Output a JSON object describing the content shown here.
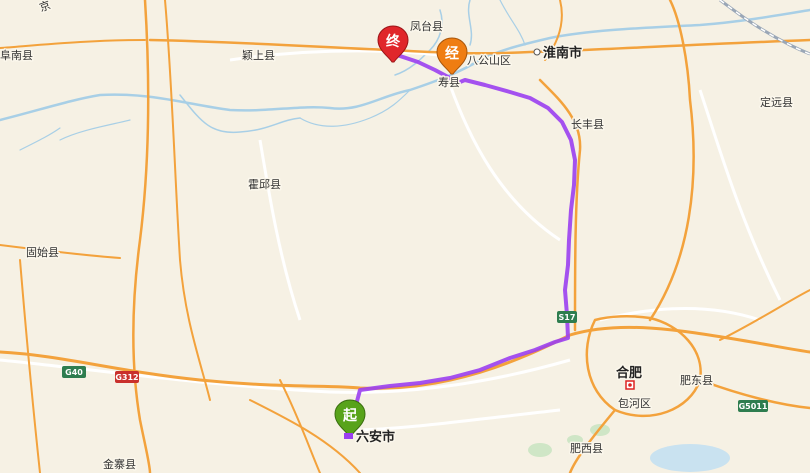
{
  "map": {
    "places": {
      "fengtai": "凤台县",
      "yingshang": "颖上县",
      "funan": "阜南县",
      "huainan": "淮南市",
      "bagongshan": "八公山区",
      "shouxian": "寿县",
      "changfeng": "长丰县",
      "dingyuan": "定远县",
      "huoqiu": "霍邱县",
      "gushi": "固始县",
      "hefei": "合肥",
      "feidong": "肥东县",
      "baohe": "包河区",
      "luan": "六安市",
      "feixi": "肥西县",
      "jinzhai": "金寨县",
      "jing": "京"
    },
    "shields": {
      "g40": "G40",
      "g312": "G312",
      "s17": "S17",
      "g5011": "G5011"
    },
    "markers": {
      "start": "起",
      "via": "经",
      "end": "终"
    },
    "colors": {
      "route": "#9b3ff0",
      "start_pin": "#58a31a",
      "via_pin": "#ef7d12",
      "end_pin": "#e0262b",
      "highway": "#f3a23c",
      "water": "#a8cfe6"
    }
  }
}
